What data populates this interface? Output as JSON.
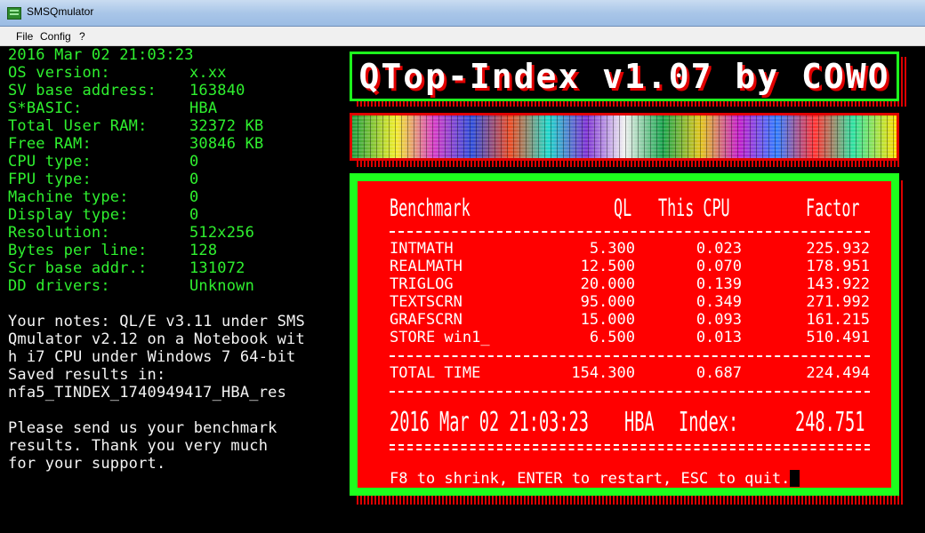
{
  "window": {
    "title": "SMSQmulator"
  },
  "menu": [
    "File",
    "Config",
    "?"
  ],
  "console": {
    "datetime": "2016 Mar 02 21:03:23",
    "sysinfo": [
      {
        "label": "OS version:",
        "value": "x.xx"
      },
      {
        "label": "SV base address:",
        "value": "163840"
      },
      {
        "label": "S*BASIC:",
        "value": "HBA"
      },
      {
        "label": "Total User RAM:",
        "value": "32372 KB"
      },
      {
        "label": "Free RAM:",
        "value": "30846 KB"
      },
      {
        "label": "CPU type:",
        "value": "0"
      },
      {
        "label": "FPU type:",
        "value": "0"
      },
      {
        "label": "Machine type:",
        "value": "0"
      },
      {
        "label": "Display type:",
        "value": "0"
      },
      {
        "label": "Resolution:",
        "value": "512x256"
      },
      {
        "label": "Bytes per line:",
        "value": "128"
      },
      {
        "label": "Scr base addr.:",
        "value": "131072"
      },
      {
        "label": "DD drivers:",
        "value": "Unknown"
      }
    ],
    "notes": [
      "Your notes: QL/E v3.11 under SMS",
      "Qmulator v2.12 on a Notebook wit",
      "h i7 CPU under Windows 7 64-bit",
      "Saved results in:",
      "nfa5_TINDEX_1740949417_HBA_res"
    ],
    "message": [
      "Please send us your benchmark",
      "results. Thank you very much",
      "for your support."
    ]
  },
  "banner": {
    "title": "QTop-Index v1.07 by COWO"
  },
  "benchmark": {
    "headers": {
      "name": "Benchmark",
      "ql": "QL",
      "cpu": "This CPU",
      "factor": "Factor"
    },
    "rows": [
      {
        "name": "INTMATH",
        "ql": "5.300",
        "cpu": "0.023",
        "factor": "225.932"
      },
      {
        "name": "REALMATH",
        "ql": "12.500",
        "cpu": "0.070",
        "factor": "178.951"
      },
      {
        "name": "TRIGLOG",
        "ql": "20.000",
        "cpu": "0.139",
        "factor": "143.922"
      },
      {
        "name": "TEXTSCRN",
        "ql": "95.000",
        "cpu": "0.349",
        "factor": "271.992"
      },
      {
        "name": "GRAFSCRN",
        "ql": "15.000",
        "cpu": "0.093",
        "factor": "161.215"
      },
      {
        "name": "STORE win1_",
        "ql": "6.500",
        "cpu": "0.013",
        "factor": "510.491"
      }
    ],
    "total": {
      "name": "TOTAL TIME",
      "ql": "154.300",
      "cpu": "0.687",
      "factor": "224.494"
    },
    "summary": {
      "datetime": "2016 Mar 02 21:03:23",
      "basic": "HBA",
      "index_label": "Index:",
      "index_value": "248.751"
    },
    "footer": "F8 to shrink, ENTER to restart, ESC to quit."
  },
  "colors": {
    "console_green": "#2ff02f",
    "panel_red": "#ff0000",
    "border_green": "#1dff1d"
  }
}
